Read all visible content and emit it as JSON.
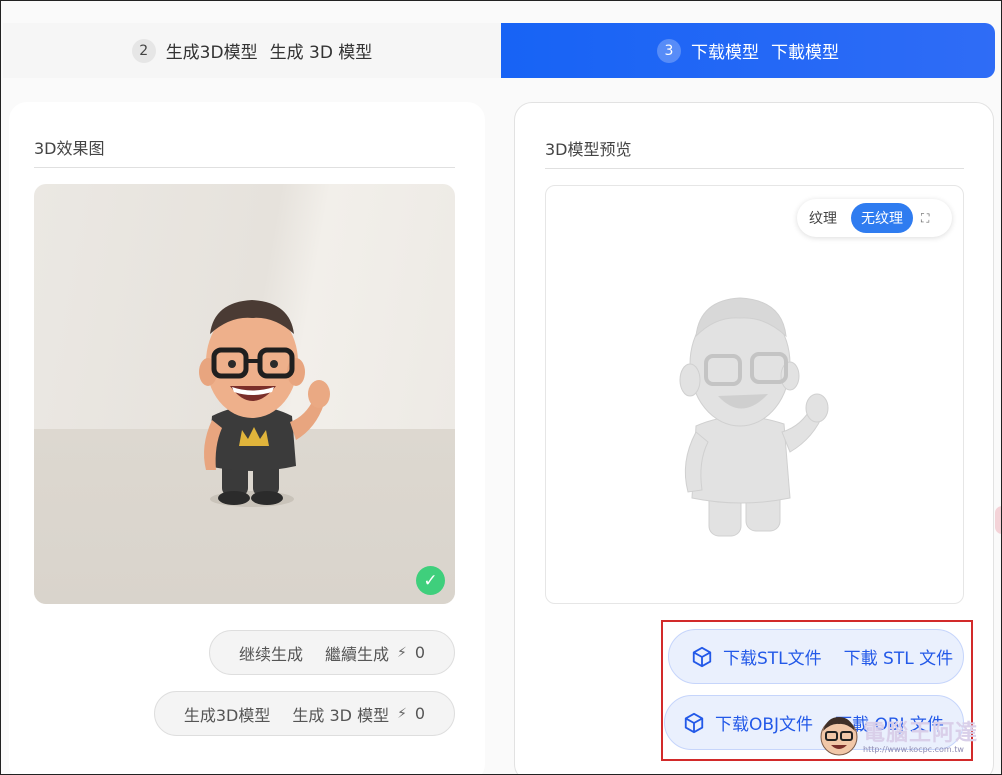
{
  "steps": [
    {
      "num": "2",
      "label": "生成3D模型",
      "label_alt": "生成 3D 模型",
      "active": false
    },
    {
      "num": "3",
      "label": "下载模型",
      "label_alt": "下載模型",
      "active": true
    }
  ],
  "left_panel": {
    "title": "3D效果图",
    "buttons": [
      {
        "label": "继续生成",
        "label_alt": "繼續生成",
        "icon": "bolt-icon",
        "count": "0"
      },
      {
        "label": "生成3D模型",
        "label_alt": "生成 3D 模型",
        "icon": "bolt-icon",
        "count": "0"
      }
    ]
  },
  "right_panel": {
    "title": "3D模型预览",
    "texture_toggle": {
      "options": [
        "纹理",
        "无纹理"
      ],
      "selected": "无纹理"
    },
    "downloads": [
      {
        "label": "下载STL文件",
        "label_alt": "下載 STL 文件",
        "icon": "cube-icon"
      },
      {
        "label": "下载OBJ文件",
        "label_alt": "下載 OBJ 文件",
        "icon": "cube-icon"
      }
    ]
  },
  "watermark": {
    "text": "電腦王阿達",
    "url": "http://www.kocpc.com.tw"
  },
  "colors": {
    "accent": "#1763f5",
    "success": "#3fcf7c",
    "highlight": "#d22a2a"
  }
}
